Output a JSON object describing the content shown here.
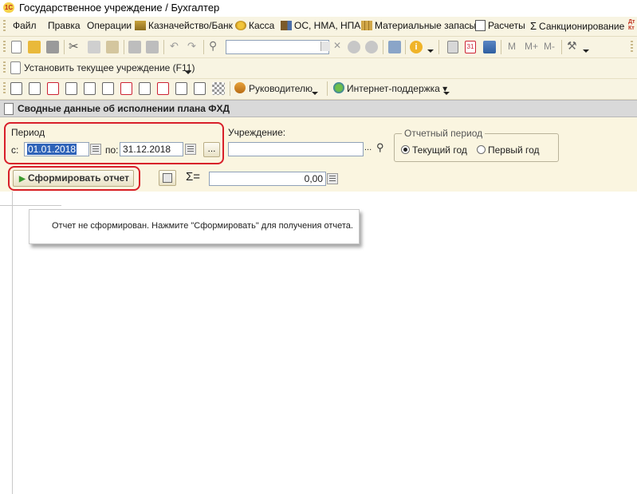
{
  "window": {
    "title": "Государственное учреждение / Бухгалтер",
    "logo": "1С"
  },
  "menu": {
    "items": [
      {
        "label": "Файл",
        "icon": "none"
      },
      {
        "label": "Правка",
        "icon": "none"
      },
      {
        "label": "Операции",
        "icon": "none"
      },
      {
        "label": "Казначейство/Банк",
        "icon": "treasury-icon"
      },
      {
        "label": "Касса",
        "icon": "coins-icon"
      },
      {
        "label": "ОС, НМА, НПА",
        "icon": "truck-icon"
      },
      {
        "label": "Материальные запасы",
        "icon": "boxes-icon"
      },
      {
        "label": "Расчеты",
        "icon": "calc-doc-icon"
      },
      {
        "label": "Санкционирование",
        "icon": "sigma-icon"
      }
    ],
    "overflow_label": "Дт Кт"
  },
  "toolbar2": {
    "install_label": "Установить текущее учреждение (F11)"
  },
  "toolbar3": {
    "manager_label": "Руководителю",
    "support_label": "Интернет-поддержка"
  },
  "document": {
    "title": "Сводные данные об исполнении плана ФХД",
    "period": {
      "group_label": "Период",
      "from_label": "с:",
      "from_value": "01.01.2018",
      "to_label": "по:",
      "to_value": "31.12.2018",
      "more_label": "..."
    },
    "institution": {
      "label": "Учреждение:",
      "value": "",
      "select_label": "..."
    },
    "reporting_period": {
      "label": "Отчетный период",
      "options": [
        "Текущий год",
        "Первый год"
      ],
      "selected": "Текущий год"
    },
    "generate_button": "Сформировать отчет",
    "sum_symbol": "Σ=",
    "sum_value": "0,00",
    "notice": "Отчет не сформирован. Нажмите \"Сформировать\" для получения отчета."
  },
  "colors": {
    "accent_red": "#d81f2a",
    "toolbar_bg": "#f8f4e2",
    "form_bg": "#faf5e0",
    "selection": "#2f63b8"
  }
}
